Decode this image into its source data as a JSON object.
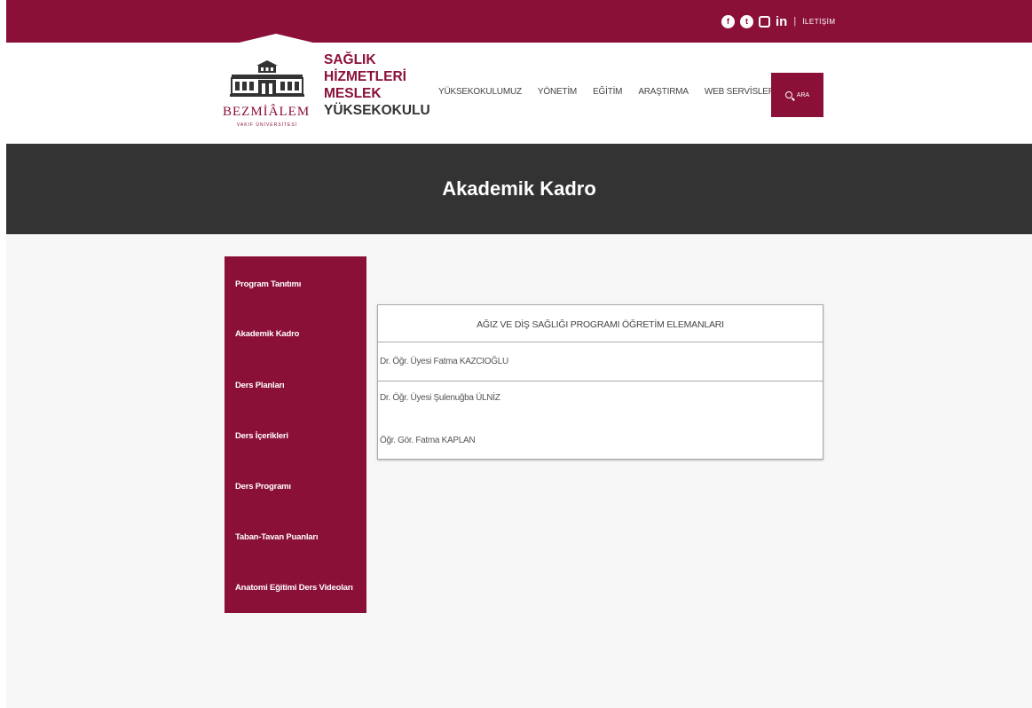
{
  "topbar": {
    "social_icons": [
      "facebook-icon",
      "twitter-icon",
      "instagram-icon",
      "linkedin-icon"
    ],
    "contact_label": "İLETİŞİM"
  },
  "logo": {
    "brand": "BEZMİÂLEM",
    "subtitle": "VAKIF ÜNİVERSİTESİ"
  },
  "school_name": {
    "line1": "SAĞLIK",
    "line2": "HİZMETLERİ",
    "line3": "MESLEK",
    "line4": "YÜKSEKOKULU"
  },
  "nav": {
    "items": [
      "YÜKSEKOKULUMUZ",
      "YÖNETİM",
      "EĞİTİM",
      "ARAŞTIRMA",
      "WEB SERVİSLER"
    ],
    "search_label": "ARA"
  },
  "page_title": "Akademik Kadro",
  "sidebar": {
    "items": [
      "Program Tanıtımı",
      "Akademik Kadro",
      "Ders Planları",
      "Ders İçerikleri",
      "Ders Programı",
      "Taban-Tavan Puanları",
      "Anatomi Eğitimi Ders Videoları"
    ]
  },
  "table": {
    "header": "AĞIZ VE DİŞ SAĞLIĞI PROGRAMI ÖĞRETİM ELEMANLARI",
    "rows": [
      "Dr. Öğr. Üyesi Fatma KAZCIOĞLU",
      "Dr. Öğr. Üyesi Şulenuğba ÜLNİZ",
      "Öğr. Gör. Fatma KAPLAN"
    ]
  },
  "colors": {
    "brand": "#8a1038",
    "band": "#333333",
    "page_bg": "#f7f7f7"
  }
}
